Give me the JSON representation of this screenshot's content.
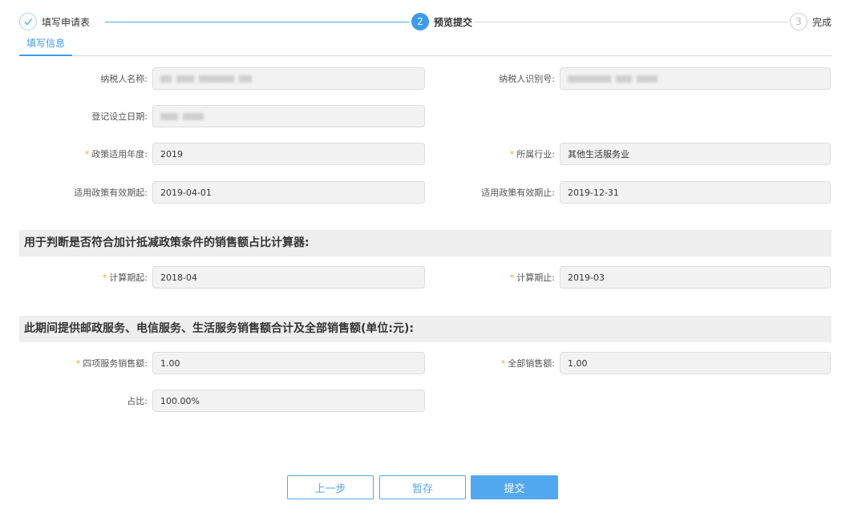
{
  "steps": [
    {
      "number": "",
      "label": "填写申请表",
      "status": "done",
      "icon": "check-icon"
    },
    {
      "number": "2",
      "label": "预览提交",
      "status": "active"
    },
    {
      "number": "3",
      "label": "完成",
      "status": "wait"
    }
  ],
  "tab": {
    "label": "填写信息"
  },
  "fields": {
    "taxpayer_name": {
      "label": "纳税人名称:",
      "value": ""
    },
    "taxpayer_id": {
      "label": "纳税人识别号:",
      "value": ""
    },
    "reg_date": {
      "label": "登记设立日期:",
      "value": ""
    },
    "policy_year": {
      "label": "政策适用年度:",
      "value": "2019",
      "required": true
    },
    "industry": {
      "label": "所属行业:",
      "value": "其他生活服务业",
      "required": true
    },
    "policy_start": {
      "label": "适用政策有效期起:",
      "value": "2019-04-01"
    },
    "policy_end": {
      "label": "适用政策有效期止:",
      "value": "2019-12-31"
    },
    "calc_start": {
      "label": "计算期起:",
      "value": "2018-04",
      "required": true
    },
    "calc_end": {
      "label": "计算期止:",
      "value": "2019-03",
      "required": true
    },
    "four_services_sales": {
      "label": "四项服务销售额:",
      "value": "1.00",
      "required": true
    },
    "total_sales": {
      "label": "全部销售额:",
      "value": "1.00",
      "required": true
    },
    "ratio": {
      "label": "占比:",
      "value": "100.00%"
    }
  },
  "sections": {
    "calculator": "用于判断是否符合加计抵减政策条件的销售额占比计算器:",
    "sales_total": "此期间提供邮政服务、电信服务、生活服务销售额合计及全部销售额(单位:元):"
  },
  "buttons": {
    "prev": "上一步",
    "save": "暂存",
    "submit": "提交"
  },
  "colors": {
    "accent": "#3d9bed",
    "button": "#52a8ec",
    "required_star": "#f5a623",
    "input_bg": "#f2f2f2",
    "section_bg": "#eeeeee"
  }
}
